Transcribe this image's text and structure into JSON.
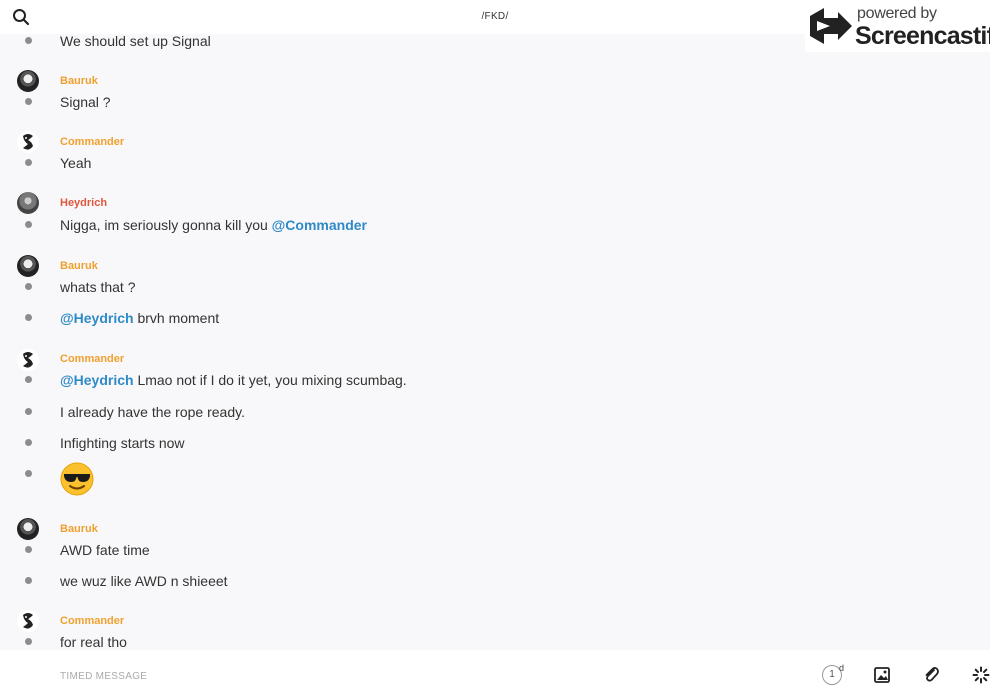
{
  "header": {
    "title": "/FKD/"
  },
  "watermark": {
    "line1": "powered by",
    "line2": "Screencastify"
  },
  "messages": [
    {
      "text": "We should set up Signal"
    },
    {
      "sender": "Bauruk",
      "text": "Signal ?"
    },
    {
      "sender": "Commander",
      "text": "Yeah"
    },
    {
      "sender": "Heydrich",
      "text": "Nigga, im seriously gonna kill you ",
      "mention": "@Commander"
    },
    {
      "sender": "Bauruk",
      "text": "whats that ?"
    },
    {
      "mention": "@Heydrich",
      "text": " brvh moment"
    },
    {
      "sender": "Commander",
      "mention": "@Heydrich",
      "text": " Lmao not if I do it yet, you mixing scumbag."
    },
    {
      "text": "I already have the rope ready."
    },
    {
      "text": "Infighting starts now"
    },
    {
      "emoji": "smiling-face-with-sunglasses"
    },
    {
      "sender": "Bauruk",
      "text": "AWD fate time"
    },
    {
      "text": "we wuz like AWD n shieeet"
    },
    {
      "sender": "Commander",
      "text": "for real tho"
    }
  ],
  "composer": {
    "placeholder": "TIMED MESSAGE",
    "timer_value": "1",
    "timer_unit": "d"
  },
  "colors": {
    "sender_orange": "#f0a02e",
    "sender_red": "#e0563d",
    "mention": "#2f8ac8"
  }
}
